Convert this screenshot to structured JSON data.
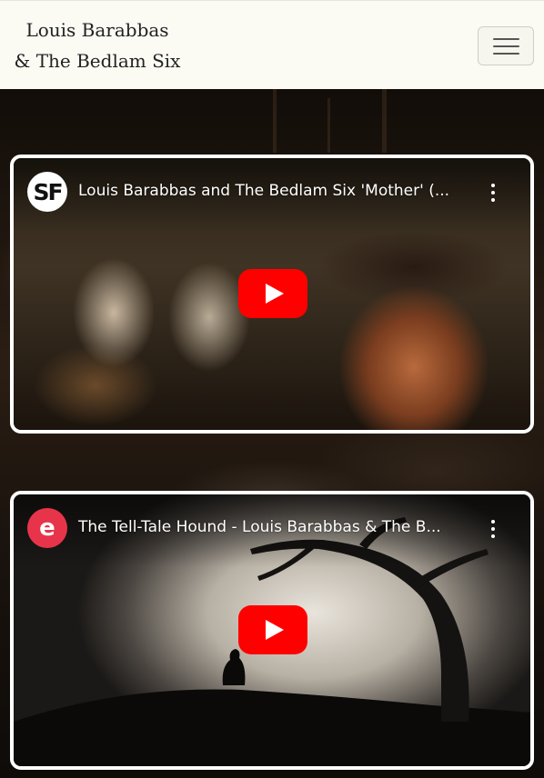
{
  "navbar": {
    "brand_line1": "Louis Barabbas",
    "brand_line2": "& The Bedlam Six",
    "menu_icon": "hamburger-menu-icon"
  },
  "videos": [
    {
      "channel_avatar_text": "SF",
      "title": "Louis Barabbas and The Bedlam Six 'Mother' (...",
      "more_icon": "more-vert-icon",
      "play_icon": "youtube-play-icon"
    },
    {
      "channel_avatar_text": "e",
      "title": "The Tell-Tale Hound - Louis Barabbas & The B...",
      "more_icon": "more-vert-icon",
      "play_icon": "youtube-play-icon"
    }
  ],
  "colors": {
    "navbar_bg": "#fbfbf4",
    "youtube_red": "#ff0000",
    "card_border": "#ffffff",
    "avatar_2_bg": "#e8344a"
  }
}
